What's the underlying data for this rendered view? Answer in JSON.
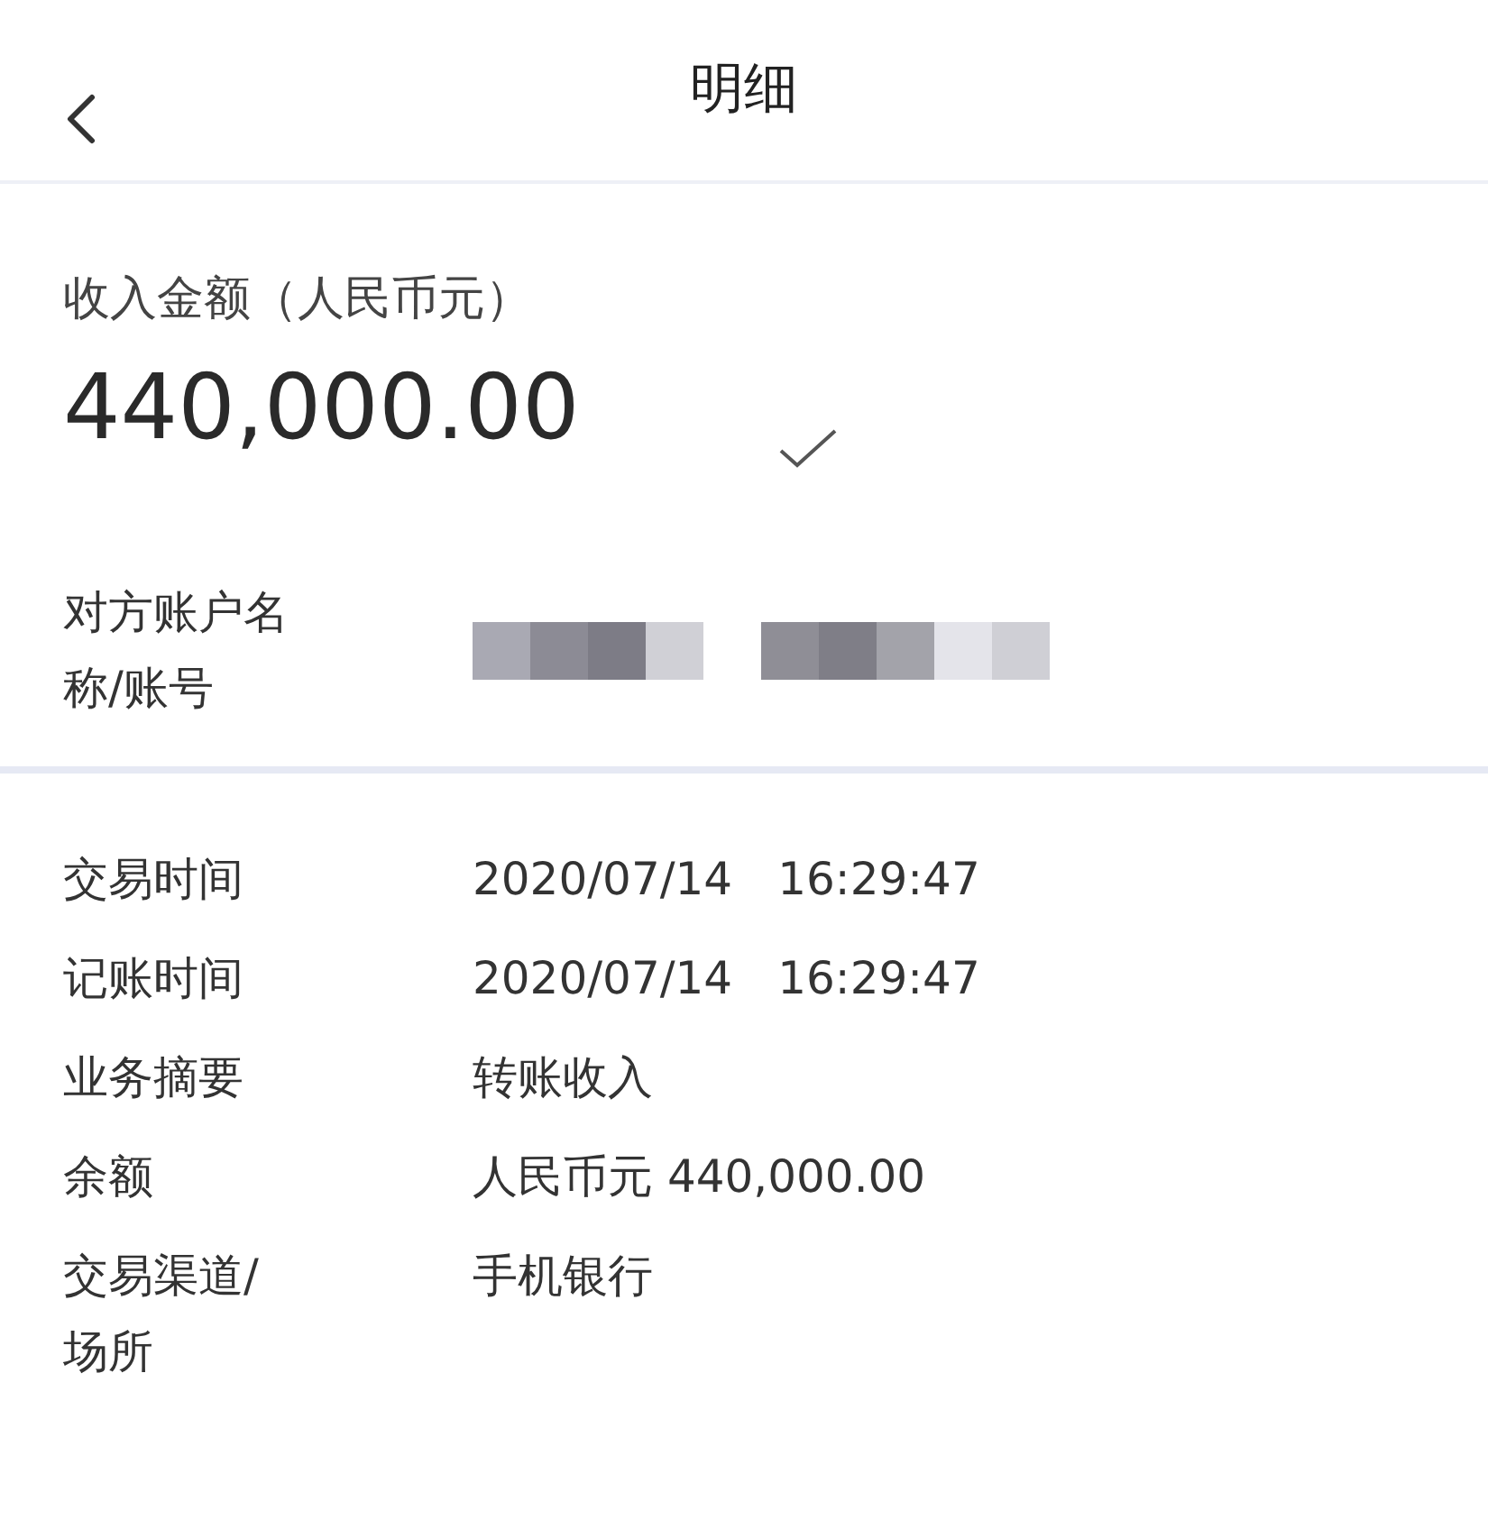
{
  "header": {
    "title": "明细"
  },
  "amount": {
    "label": "收入金额（人民币元）",
    "value": "440,000.00"
  },
  "counterparty": {
    "label": "对方账户名称/账号"
  },
  "details": [
    {
      "label": "交易时间",
      "value": "2020/07/14　16:29:47"
    },
    {
      "label": "记账时间",
      "value": "2020/07/14　16:29:47"
    },
    {
      "label": "业务摘要",
      "value": "转账收入"
    },
    {
      "label": "余额",
      "value": "人民币元 440,000.00"
    },
    {
      "label": "交易渠道/场所",
      "value": "手机银行"
    }
  ]
}
